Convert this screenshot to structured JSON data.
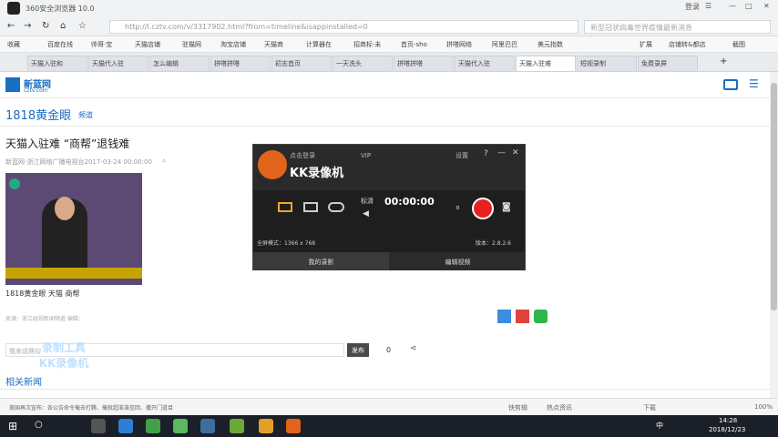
{
  "browser": {
    "title": "360安全浏览器 10.0",
    "login": "登录",
    "url": "http://l.cztv.com/v/3317902.html?from=timeline&isappinstalled=0",
    "search_placeholder": "新型冠状病毒世界疫情最新消息"
  },
  "bookmarks": [
    "收藏",
    "百度在线",
    "帅哥·宝",
    "天猫店铺",
    "驻猫网",
    "淘宝店铺",
    "天猫商",
    "计算器在",
    "招商标·未",
    "首页-sho",
    "拼嗒网络",
    "阿里巴巴",
    "美元指数",
    "扩展",
    "店铺转&都店",
    "截图"
  ],
  "tabs": [
    "天猫入驻和",
    "天猫代入驻",
    "怎么编辑",
    "拼嗒拼嗒",
    "初志首页",
    "一天洗头",
    "拼嗒拼嗒",
    "天猫代入驻",
    "天猫入驻难",
    "短视录制",
    "免费录屏"
  ],
  "site": {
    "logo_text": "新蓝网",
    "logo_sub": "cztv.com",
    "channel": "1818黄金眼",
    "channel_suffix": "频道",
    "article_title": "天猫入驻难 “商帮”退钱难",
    "meta": "新蓝网-浙江网络广播电视台2017-03-24 00:00:00",
    "caption": "1818黄金眼 天猫 商帮",
    "source": "来源：浙江经视新闻频道 编辑：",
    "comment_placeholder": "我来说两句",
    "publish": "发布",
    "count": "0",
    "related": "相关新闻"
  },
  "kk": {
    "login": "点击登录",
    "vip": "VIP",
    "name": "KK录像机",
    "settings": "设置",
    "mode_label": "标清",
    "timer": "00:00:00",
    "status_left": "全屏模式：1366 x 768",
    "version": "版本：2.8.2.6",
    "btn_left": "我的录影",
    "btn_right": "编辑视频"
  },
  "watermark": {
    "line1": "录制工具",
    "line2": "KK录像机"
  },
  "status": {
    "left": "美国再次宣布：各公告命令俺去打腾、俺就超准准信回、撒开门道目",
    "items": [
      "快剪辑",
      "热点资讯",
      "下载"
    ],
    "zoom": "100%"
  },
  "taskbar": {
    "time": "14:28",
    "date": "2018/12/23",
    "lang": "中"
  }
}
